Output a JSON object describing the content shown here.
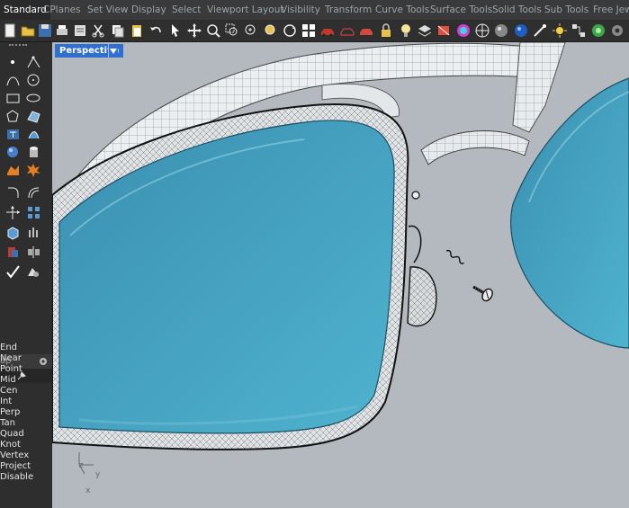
{
  "menu_tabs": [
    "Standard",
    "CPlanes",
    "Set View",
    "Display",
    "Select",
    "Viewport Layout",
    "Visibility",
    "Transform",
    "Curve Tools",
    "Surface Tools",
    "Solid Tools",
    "Sub Tools",
    "Free Jew"
  ],
  "active_tab": "Standard",
  "viewport": {
    "title": "Perspective",
    "dropdown_icon": "triangle-down",
    "axes": {
      "x": "x",
      "y": "y",
      "z": "z"
    }
  },
  "osnap": {
    "header": "ap",
    "items": [
      "End",
      "Near",
      "Point",
      "Mid",
      "Cen",
      "Int",
      "Perp",
      "Tan",
      "Quad",
      "Knot",
      "Vertex",
      "Project",
      "Disable"
    ]
  },
  "colors": {
    "lens": "#3a9fc1",
    "viewport_bg": "#b3b9bf",
    "active_tab": "#2f6fd0"
  }
}
